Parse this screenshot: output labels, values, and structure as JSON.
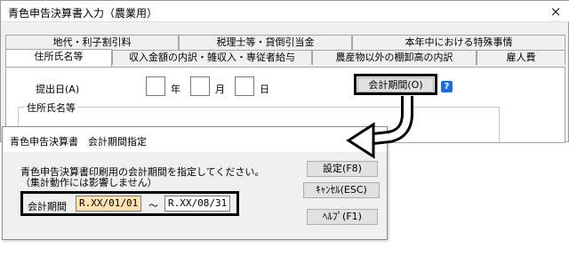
{
  "main_window": {
    "title": "青色申告決算書入力（農業用）",
    "close_glyph": "×",
    "tabs_row1": [
      "地代・利子割引料",
      "税理士等・貸倒引当金",
      "本年中における特殊事情"
    ],
    "tabs_row2": [
      "住所氏名等",
      "収入金額の内訳・雑収入・専従者給与",
      "農産物以外の棚卸高の内訳",
      "雇人費"
    ],
    "filing_date_label": "提出日(A)",
    "date_units": [
      "年",
      "月",
      "日"
    ],
    "accounting_period_button": "会計期間(O)",
    "help_icon": "question-icon",
    "group_label": "住所氏名等"
  },
  "dialog": {
    "title": "青色申告決算書　会計期間指定",
    "close_glyph": "×",
    "message_line1": "青色申告決算書印刷用の会計期間を指定してください。",
    "message_line2": "（集計動作には影響しません）",
    "period_label": "会計期間",
    "start_value": "R.XX/01/01",
    "separator": "～",
    "end_value": "R.XX/08/31",
    "buttons": {
      "set": "設定(F8)",
      "cancel": "ｷｬﾝｾﾙ(ESC)",
      "help": "ﾍﾙﾌﾟ(F1)"
    }
  },
  "colors": {
    "start_field_bg": "#ffe3b3",
    "end_field_bg": "#ffffff",
    "help_icon": "#1e6fd9"
  }
}
